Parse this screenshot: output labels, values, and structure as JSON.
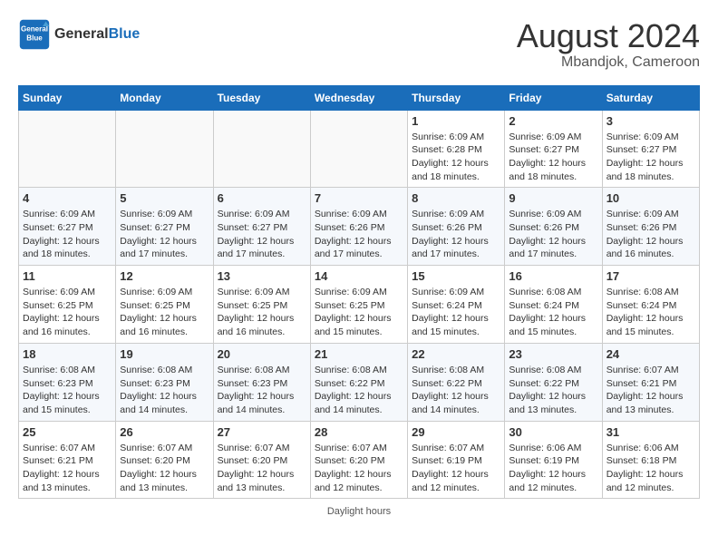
{
  "header": {
    "logo_line1": "General",
    "logo_line2": "Blue",
    "month": "August 2024",
    "location": "Mbandjok, Cameroon"
  },
  "weekdays": [
    "Sunday",
    "Monday",
    "Tuesday",
    "Wednesday",
    "Thursday",
    "Friday",
    "Saturday"
  ],
  "weeks": [
    [
      {
        "day": "",
        "info": ""
      },
      {
        "day": "",
        "info": ""
      },
      {
        "day": "",
        "info": ""
      },
      {
        "day": "",
        "info": ""
      },
      {
        "day": "1",
        "info": "Sunrise: 6:09 AM\nSunset: 6:28 PM\nDaylight: 12 hours\nand 18 minutes."
      },
      {
        "day": "2",
        "info": "Sunrise: 6:09 AM\nSunset: 6:27 PM\nDaylight: 12 hours\nand 18 minutes."
      },
      {
        "day": "3",
        "info": "Sunrise: 6:09 AM\nSunset: 6:27 PM\nDaylight: 12 hours\nand 18 minutes."
      }
    ],
    [
      {
        "day": "4",
        "info": "Sunrise: 6:09 AM\nSunset: 6:27 PM\nDaylight: 12 hours\nand 18 minutes."
      },
      {
        "day": "5",
        "info": "Sunrise: 6:09 AM\nSunset: 6:27 PM\nDaylight: 12 hours\nand 17 minutes."
      },
      {
        "day": "6",
        "info": "Sunrise: 6:09 AM\nSunset: 6:27 PM\nDaylight: 12 hours\nand 17 minutes."
      },
      {
        "day": "7",
        "info": "Sunrise: 6:09 AM\nSunset: 6:26 PM\nDaylight: 12 hours\nand 17 minutes."
      },
      {
        "day": "8",
        "info": "Sunrise: 6:09 AM\nSunset: 6:26 PM\nDaylight: 12 hours\nand 17 minutes."
      },
      {
        "day": "9",
        "info": "Sunrise: 6:09 AM\nSunset: 6:26 PM\nDaylight: 12 hours\nand 17 minutes."
      },
      {
        "day": "10",
        "info": "Sunrise: 6:09 AM\nSunset: 6:26 PM\nDaylight: 12 hours\nand 16 minutes."
      }
    ],
    [
      {
        "day": "11",
        "info": "Sunrise: 6:09 AM\nSunset: 6:25 PM\nDaylight: 12 hours\nand 16 minutes."
      },
      {
        "day": "12",
        "info": "Sunrise: 6:09 AM\nSunset: 6:25 PM\nDaylight: 12 hours\nand 16 minutes."
      },
      {
        "day": "13",
        "info": "Sunrise: 6:09 AM\nSunset: 6:25 PM\nDaylight: 12 hours\nand 16 minutes."
      },
      {
        "day": "14",
        "info": "Sunrise: 6:09 AM\nSunset: 6:25 PM\nDaylight: 12 hours\nand 15 minutes."
      },
      {
        "day": "15",
        "info": "Sunrise: 6:09 AM\nSunset: 6:24 PM\nDaylight: 12 hours\nand 15 minutes."
      },
      {
        "day": "16",
        "info": "Sunrise: 6:08 AM\nSunset: 6:24 PM\nDaylight: 12 hours\nand 15 minutes."
      },
      {
        "day": "17",
        "info": "Sunrise: 6:08 AM\nSunset: 6:24 PM\nDaylight: 12 hours\nand 15 minutes."
      }
    ],
    [
      {
        "day": "18",
        "info": "Sunrise: 6:08 AM\nSunset: 6:23 PM\nDaylight: 12 hours\nand 15 minutes."
      },
      {
        "day": "19",
        "info": "Sunrise: 6:08 AM\nSunset: 6:23 PM\nDaylight: 12 hours\nand 14 minutes."
      },
      {
        "day": "20",
        "info": "Sunrise: 6:08 AM\nSunset: 6:23 PM\nDaylight: 12 hours\nand 14 minutes."
      },
      {
        "day": "21",
        "info": "Sunrise: 6:08 AM\nSunset: 6:22 PM\nDaylight: 12 hours\nand 14 minutes."
      },
      {
        "day": "22",
        "info": "Sunrise: 6:08 AM\nSunset: 6:22 PM\nDaylight: 12 hours\nand 14 minutes."
      },
      {
        "day": "23",
        "info": "Sunrise: 6:08 AM\nSunset: 6:22 PM\nDaylight: 12 hours\nand 13 minutes."
      },
      {
        "day": "24",
        "info": "Sunrise: 6:07 AM\nSunset: 6:21 PM\nDaylight: 12 hours\nand 13 minutes."
      }
    ],
    [
      {
        "day": "25",
        "info": "Sunrise: 6:07 AM\nSunset: 6:21 PM\nDaylight: 12 hours\nand 13 minutes."
      },
      {
        "day": "26",
        "info": "Sunrise: 6:07 AM\nSunset: 6:20 PM\nDaylight: 12 hours\nand 13 minutes."
      },
      {
        "day": "27",
        "info": "Sunrise: 6:07 AM\nSunset: 6:20 PM\nDaylight: 12 hours\nand 13 minutes."
      },
      {
        "day": "28",
        "info": "Sunrise: 6:07 AM\nSunset: 6:20 PM\nDaylight: 12 hours\nand 12 minutes."
      },
      {
        "day": "29",
        "info": "Sunrise: 6:07 AM\nSunset: 6:19 PM\nDaylight: 12 hours\nand 12 minutes."
      },
      {
        "day": "30",
        "info": "Sunrise: 6:06 AM\nSunset: 6:19 PM\nDaylight: 12 hours\nand 12 minutes."
      },
      {
        "day": "31",
        "info": "Sunrise: 6:06 AM\nSunset: 6:18 PM\nDaylight: 12 hours\nand 12 minutes."
      }
    ]
  ],
  "footer": {
    "label": "Daylight hours"
  }
}
